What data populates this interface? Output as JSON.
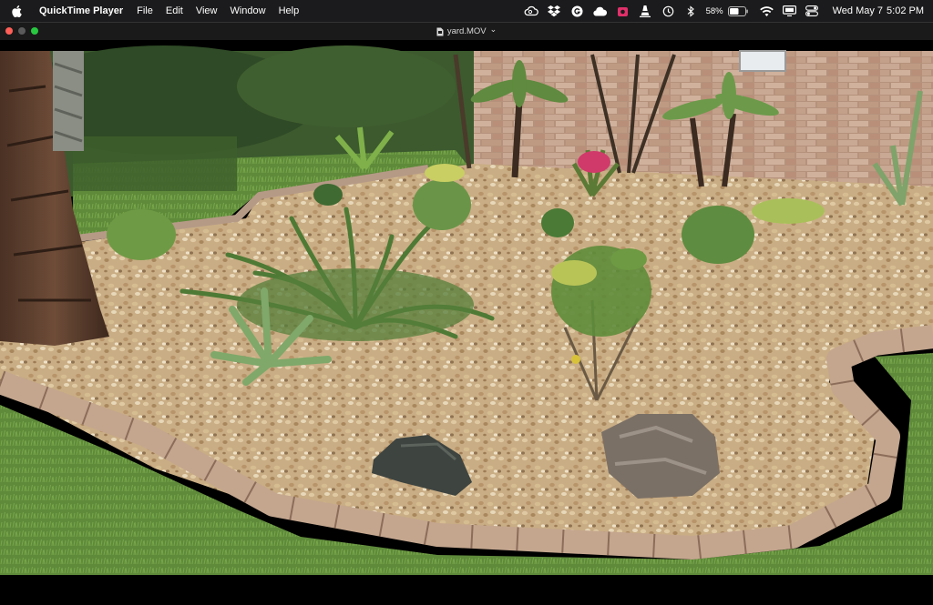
{
  "menubar": {
    "app_name": "QuickTime Player",
    "menus": [
      "File",
      "Edit",
      "View",
      "Window",
      "Help"
    ],
    "battery_percent": "58%",
    "clock_date": "Wed May 7",
    "clock_time": "5:02 PM",
    "status_icons": [
      "creative-cloud-icon",
      "dropbox-icon",
      "grammarly-icon",
      "cloud-icon",
      "record-icon",
      "vlc-icon",
      "time-machine-icon",
      "bluetooth-icon",
      "battery-icon",
      "wifi-icon",
      "display-icon",
      "control-center-icon"
    ]
  },
  "window": {
    "title": "yard.MOV",
    "title_chevron": "⌄",
    "traffic_colors": {
      "close": "#ff5f57",
      "minimize": "#5a5a5a",
      "zoom": "#28c840"
    }
  },
  "video": {
    "content": "backyard garden bed with gravel, plants, palms, rocks and brick border"
  }
}
